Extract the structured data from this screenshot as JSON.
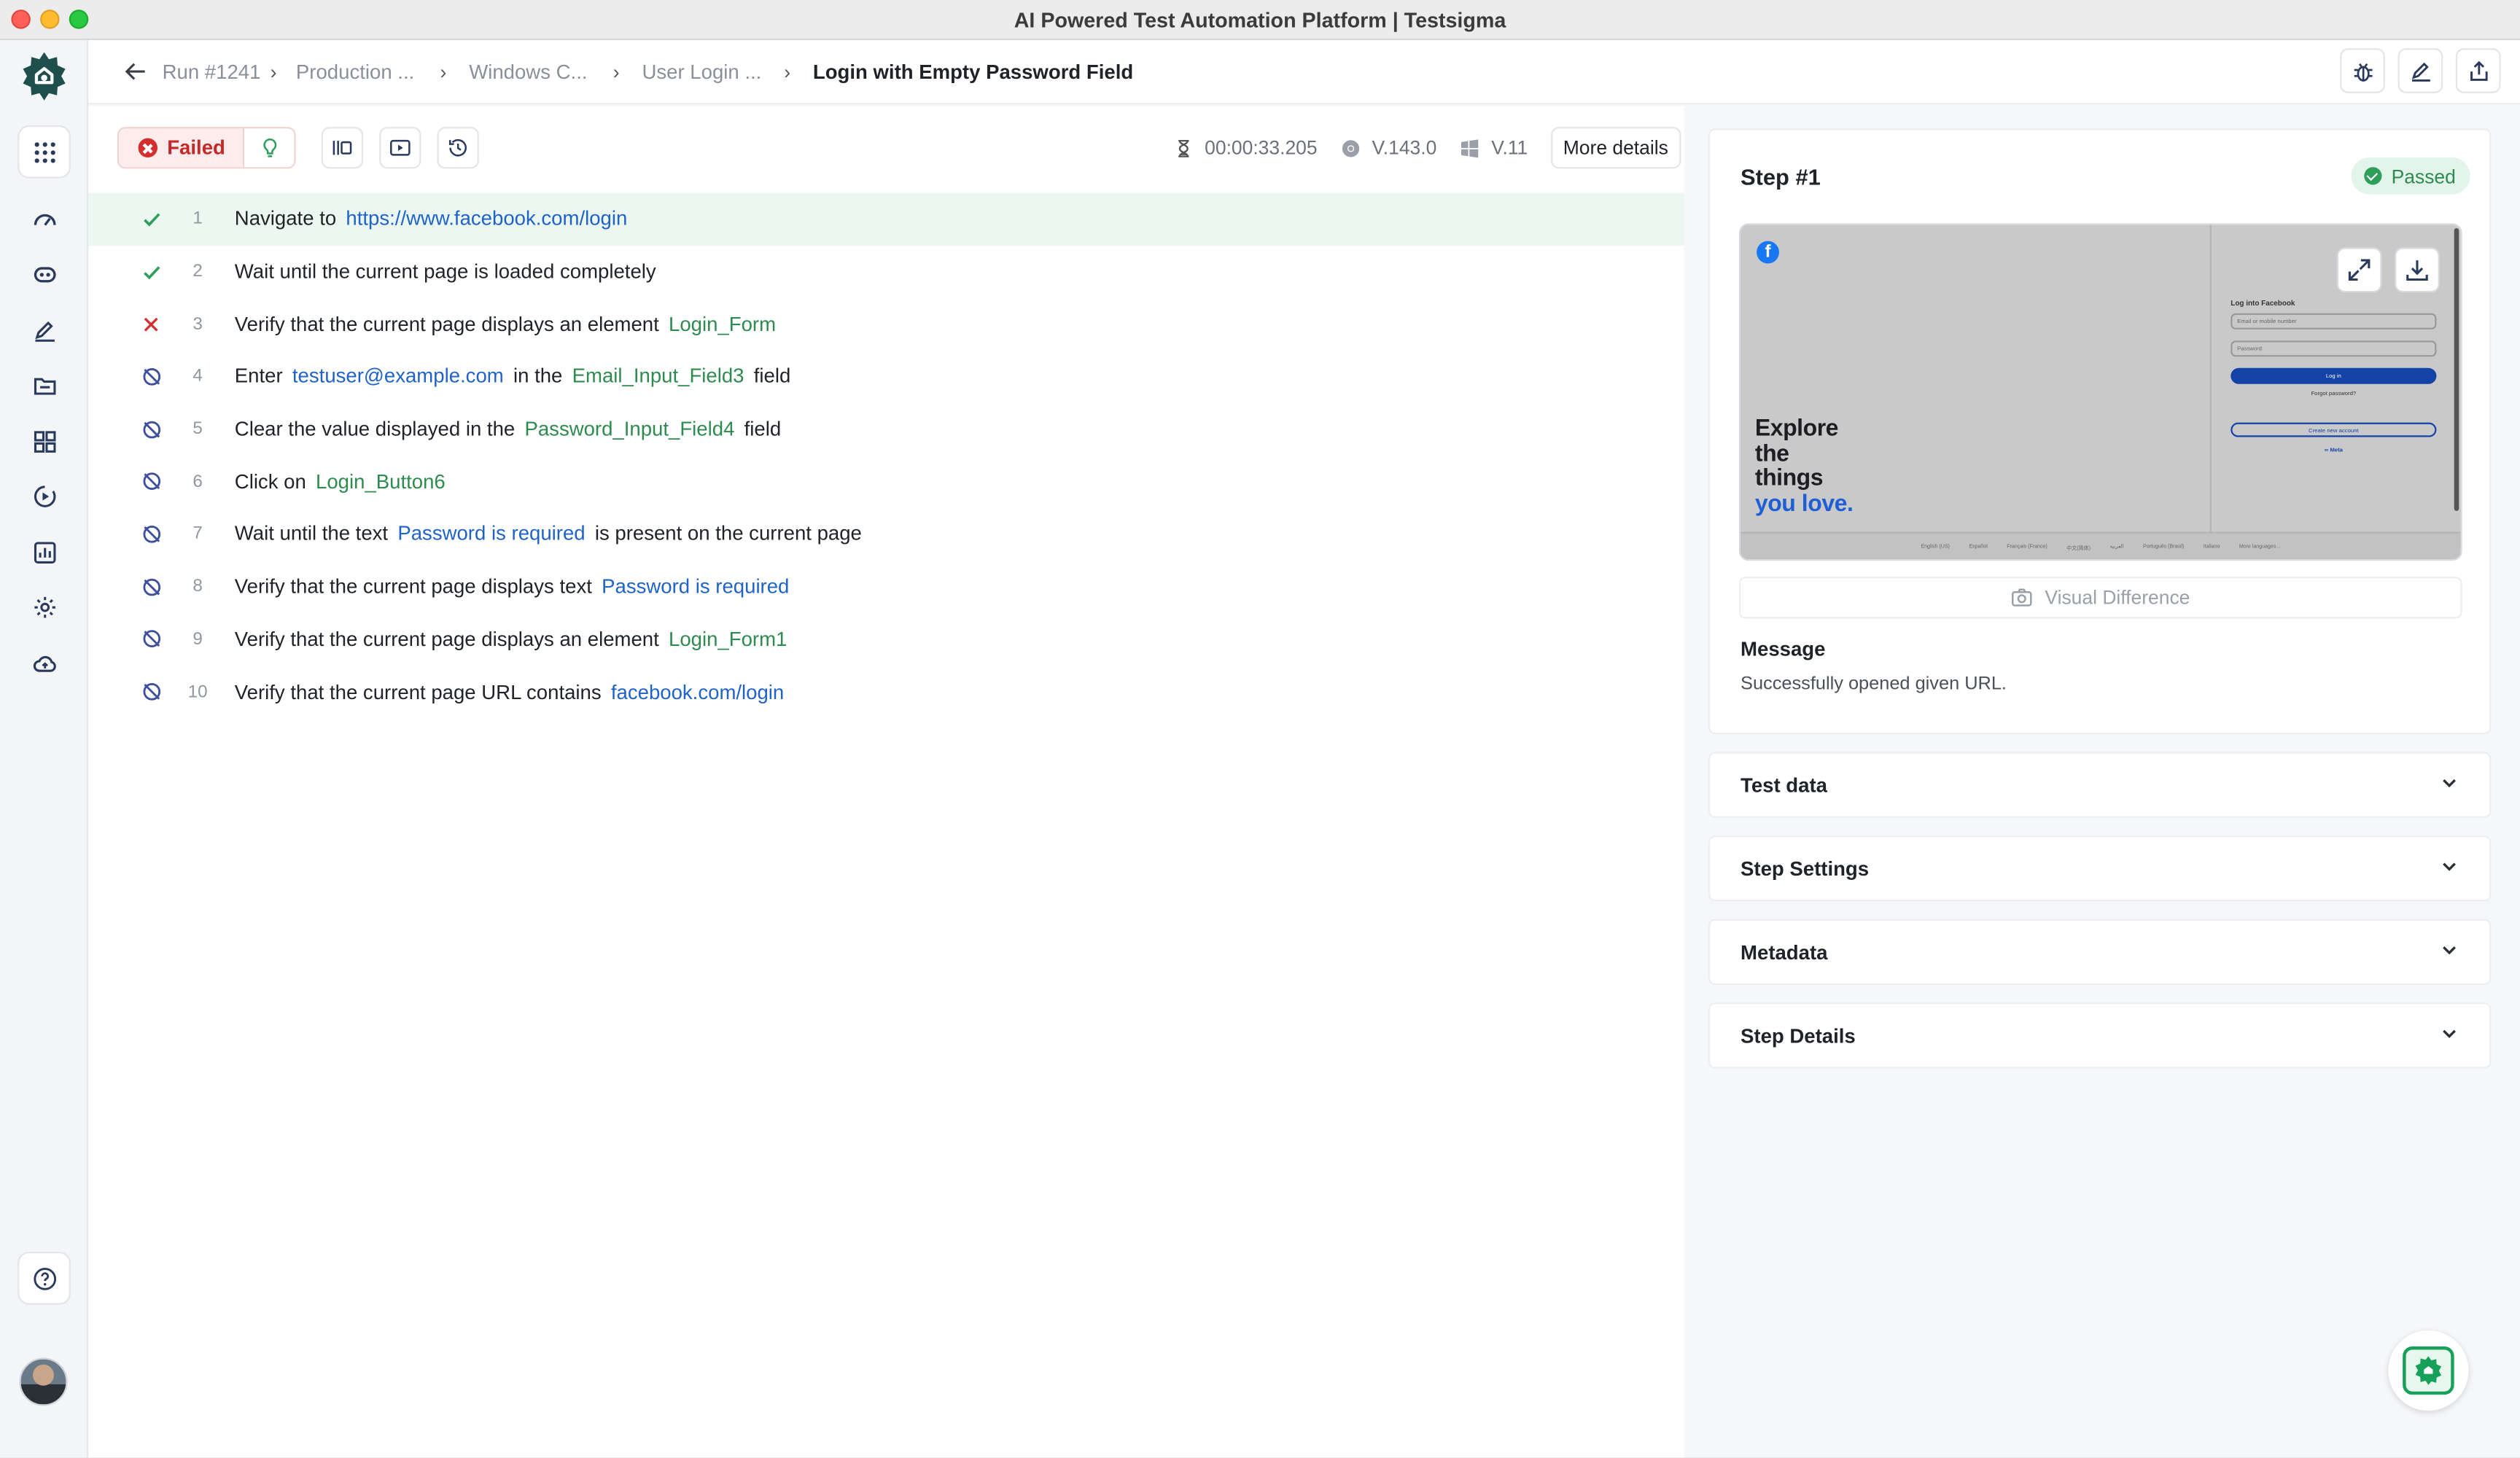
{
  "window": {
    "title": "AI Powered Test Automation Platform | Testsigma"
  },
  "sidebar": {
    "items": [
      {
        "name": "apps-grid-icon"
      },
      {
        "name": "dashboard-gauge-icon"
      },
      {
        "name": "agent-robot-icon"
      },
      {
        "name": "edit-pencil-icon"
      },
      {
        "name": "folder-icon"
      },
      {
        "name": "modules-icon"
      },
      {
        "name": "run-play-icon"
      },
      {
        "name": "reports-chart-icon"
      },
      {
        "name": "settings-gear-icon"
      },
      {
        "name": "cloud-upload-icon"
      }
    ],
    "help_icon": "help-circle-icon"
  },
  "breadcrumb": {
    "items": [
      "Run #1241",
      "Production ...",
      "Windows C...",
      "User Login ...",
      "Login with Empty Password Field"
    ]
  },
  "toolbar": {
    "status": "Failed",
    "duration": "00:00:33.205",
    "browser_version": "V.143.0",
    "os_version": "V.11",
    "more_details": "More details"
  },
  "steps": [
    {
      "num": "1",
      "status": "pass",
      "parts": [
        {
          "t": "Navigate to",
          "k": "text"
        },
        {
          "t": "https://www.facebook.com/login",
          "k": "link"
        }
      ]
    },
    {
      "num": "2",
      "status": "pass",
      "parts": [
        {
          "t": "Wait until the current page is loaded completely",
          "k": "text"
        }
      ]
    },
    {
      "num": "3",
      "status": "fail",
      "parts": [
        {
          "t": "Verify that the current page displays an element",
          "k": "text"
        },
        {
          "t": "Login_Form",
          "k": "el"
        }
      ]
    },
    {
      "num": "4",
      "status": "skip",
      "parts": [
        {
          "t": "Enter",
          "k": "text"
        },
        {
          "t": "testuser@example.com",
          "k": "link"
        },
        {
          "t": "in the",
          "k": "text"
        },
        {
          "t": "Email_Input_Field3",
          "k": "el"
        },
        {
          "t": "field",
          "k": "text"
        }
      ]
    },
    {
      "num": "5",
      "status": "skip",
      "parts": [
        {
          "t": "Clear the value displayed in the",
          "k": "text"
        },
        {
          "t": "Password_Input_Field4",
          "k": "el"
        },
        {
          "t": "field",
          "k": "text"
        }
      ]
    },
    {
      "num": "6",
      "status": "skip",
      "parts": [
        {
          "t": "Click on",
          "k": "text"
        },
        {
          "t": "Login_Button6",
          "k": "el"
        }
      ]
    },
    {
      "num": "7",
      "status": "skip",
      "parts": [
        {
          "t": "Wait until the text",
          "k": "text"
        },
        {
          "t": "Password is required",
          "k": "link"
        },
        {
          "t": "is present on the current page",
          "k": "text"
        }
      ]
    },
    {
      "num": "8",
      "status": "skip",
      "parts": [
        {
          "t": "Verify that the current page displays text",
          "k": "text"
        },
        {
          "t": "Password is required",
          "k": "link"
        }
      ]
    },
    {
      "num": "9",
      "status": "skip",
      "parts": [
        {
          "t": "Verify that the current page displays an element",
          "k": "text"
        },
        {
          "t": "Login_Form1",
          "k": "el"
        }
      ]
    },
    {
      "num": "10",
      "status": "skip",
      "parts": [
        {
          "t": "Verify that the current page URL contains",
          "k": "text"
        },
        {
          "t": "facebook.com/login",
          "k": "link"
        }
      ]
    }
  ],
  "step_panel": {
    "title": "Step #1",
    "status": "Passed",
    "screenshot": {
      "logo_letter": "f",
      "hero_line1": "Explore",
      "hero_line2": "the",
      "hero_line3": "things",
      "hero_line4": "you love.",
      "form_title": "Log into Facebook",
      "email_placeholder": "Email or mobile number",
      "password_placeholder": "Password",
      "login_button": "Log in",
      "forgot": "Forgot password?",
      "create": "Create new account",
      "meta": "∞ Meta",
      "footer": [
        "English (US)",
        "Español",
        "Français (France)",
        "中文(简体)",
        "العربية",
        "Português (Brasil)",
        "Italiano",
        "More languages..."
      ]
    },
    "visual_difference": "Visual Difference",
    "message_label": "Message",
    "message": "Successfully opened given URL."
  },
  "accordions": [
    "Test data",
    "Step Settings",
    "Metadata",
    "Step Details"
  ],
  "colors": {
    "accent_green": "#2e8b4f",
    "fail_red": "#d32f2f",
    "link_blue": "#1f63c9",
    "skip_indigo": "#3d4fa0"
  }
}
